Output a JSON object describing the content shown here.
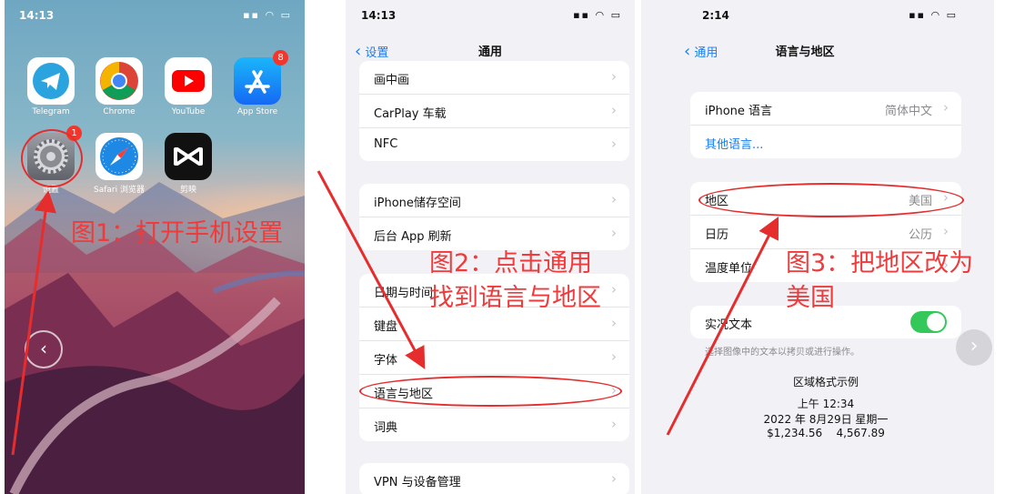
{
  "panel1": {
    "time": "14:13",
    "apps": [
      {
        "name": "Telegram",
        "icon": "telegram-icon"
      },
      {
        "name": "Chrome",
        "icon": "chrome-icon"
      },
      {
        "name": "YouTube",
        "icon": "youtube-icon"
      },
      {
        "name": "App Store",
        "icon": "app-store-icon",
        "badge": "8"
      },
      {
        "name": "设置",
        "icon": "settings-gear-icon",
        "badge": "1"
      },
      {
        "name": "Safari 浏览器",
        "icon": "safari-icon"
      },
      {
        "name": "剪映",
        "icon": "capcut-icon"
      }
    ],
    "caption": "图1：打开手机设置"
  },
  "panel2": {
    "time": "14:13",
    "back": "设置",
    "title": "通用",
    "groups": [
      [
        {
          "label": "画中画"
        },
        {
          "label": "CarPlay 车载"
        },
        {
          "label": "NFC"
        }
      ],
      [
        {
          "label": "iPhone储存空间"
        },
        {
          "label": "后台 App 刷新"
        }
      ],
      [
        {
          "label": "日期与时间"
        },
        {
          "label": "键盘"
        },
        {
          "label": "字体"
        },
        {
          "label": "语言与地区"
        },
        {
          "label": "词典"
        }
      ],
      [
        {
          "label": "VPN 与设备管理"
        }
      ]
    ],
    "caption_line1": "图2：点击通用",
    "caption_line2": "找到语言与地区"
  },
  "panel3": {
    "time": "2:14",
    "back": "通用",
    "title": "语言与地区",
    "group1": [
      {
        "label": "iPhone 语言",
        "value": "简体中文"
      },
      {
        "label": "其他语言..."
      }
    ],
    "group2": [
      {
        "label": "地区",
        "value": "美国"
      },
      {
        "label": "日历",
        "value": "公历"
      },
      {
        "label": "温度单位",
        "value": ""
      }
    ],
    "live_text": {
      "label": "实况文本",
      "on": true
    },
    "live_text_note": "选择图像中的文本以拷贝或进行操作。",
    "example_title": "区域格式示例",
    "example_time": "上午 12:34",
    "example_date": "2022 年 8月29日 星期一",
    "example_numbers": "$1,234.56    4,567.89",
    "caption_line1": "图3：把地区改为",
    "caption_line2": "美国"
  },
  "colors": {
    "accent": "#1a7cf3",
    "annotation": "#e52d2d",
    "toggle_on": "#34c759"
  }
}
